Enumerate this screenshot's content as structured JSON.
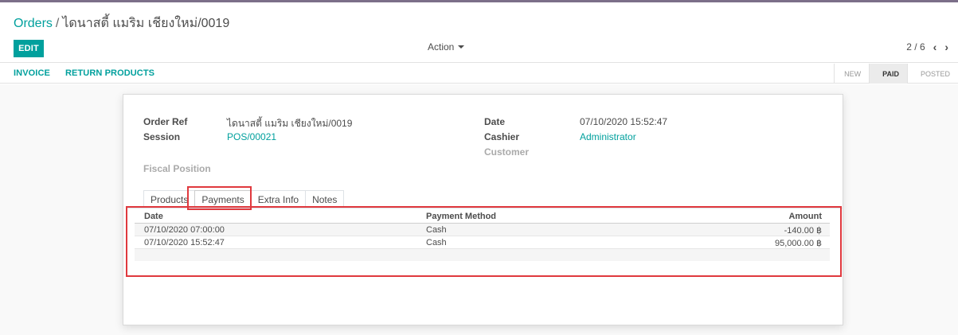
{
  "breadcrumb": {
    "parent": "Orders",
    "separator": "/",
    "current": "ไดนาสตี้ แมริม เชียงใหม่/0019"
  },
  "toolbar": {
    "edit_label": "EDIT",
    "action_label": "Action"
  },
  "pager": {
    "value": "2 / 6",
    "prev": "‹",
    "next": "›"
  },
  "statusbar": {
    "buttons": [
      "INVOICE",
      "RETURN PRODUCTS"
    ],
    "states": [
      "NEW",
      "PAID",
      "POSTED"
    ],
    "active_state": "PAID"
  },
  "form": {
    "order_ref_label": "Order Ref",
    "order_ref_value": "ไดนาสตี้ แมริม เชียงใหม่/0019",
    "session_label": "Session",
    "session_value": "POS/00021",
    "fiscal_position_label": "Fiscal Position",
    "date_label": "Date",
    "date_value": "07/10/2020 15:52:47",
    "cashier_label": "Cashier",
    "cashier_value": "Administrator",
    "customer_label": "Customer"
  },
  "tabs": [
    "Products",
    "Payments",
    "Extra Info",
    "Notes"
  ],
  "active_tab": "Payments",
  "payments": {
    "headers": [
      "Date",
      "Payment Method",
      "Amount"
    ],
    "rows": [
      [
        "07/10/2020 07:00:00",
        "Cash",
        "-140.00 ฿"
      ],
      [
        "07/10/2020 15:52:47",
        "Cash",
        "95,000.00 ฿"
      ]
    ]
  },
  "colors": {
    "accent": "#00a09d",
    "topbar": "#7c6f89",
    "highlight": "#e0393e"
  }
}
